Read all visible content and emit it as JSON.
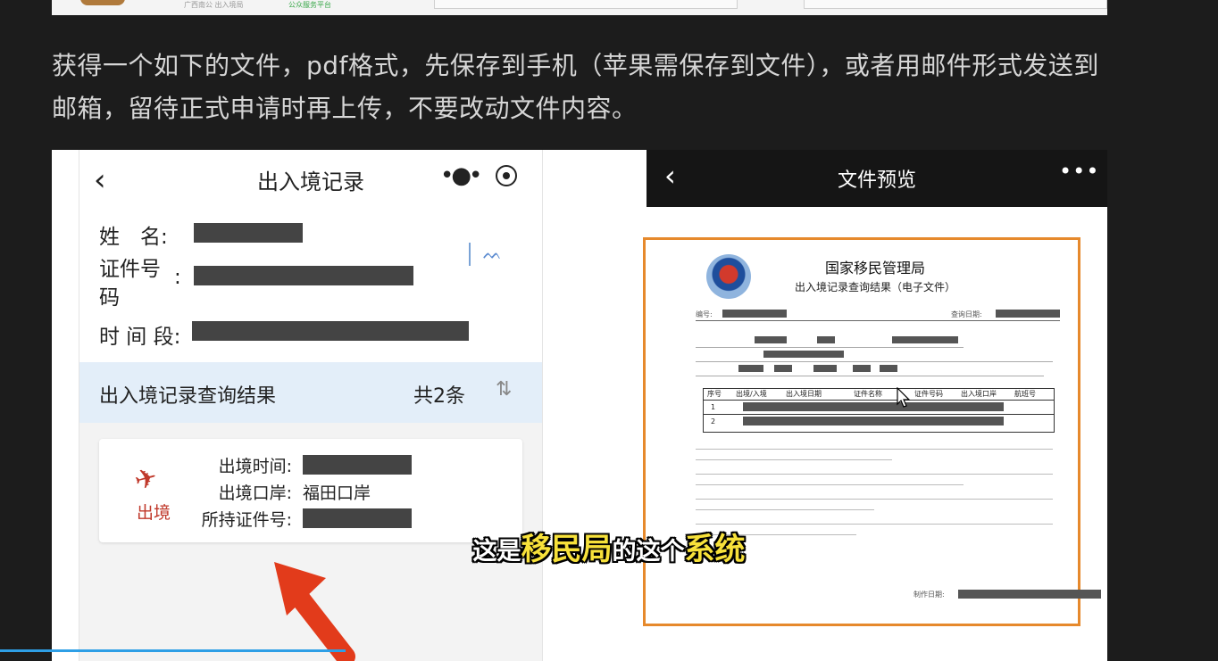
{
  "top_strip": {
    "left_text": "广西南公 出入境局",
    "green_text": "公众服务平台"
  },
  "intro_text": "获得一个如下的文件，pdf格式，先保存到手机（苹果需保存到文件），或者用邮件形式发送到邮箱，留待正式申请时再上传，不要改动文件内容。",
  "phone": {
    "title": "出入境记录",
    "fields": {
      "name_label": "姓　名:",
      "id_label": "证件号",
      "id_label_line2": "码",
      "id_colon": ":",
      "period_label": "时 间 段:"
    },
    "result_bar": {
      "title": "出入境记录查询结果",
      "count": "共2条"
    },
    "record": {
      "tag": "出境",
      "time_label": "出境时间:",
      "port_label": "出境口岸:",
      "port_value": "福田口岸",
      "doc_label": "所持证件号:"
    }
  },
  "viewer": {
    "title": "文件预览",
    "doc_org": "国家移民管理局",
    "doc_subtitle": "出入境记录查询结果（电子文件）",
    "doc_no_label": "编号:",
    "doc_date_label": "查询日期:",
    "table_headers": [
      "序号",
      "出境/入境",
      "出入境日期",
      "证件名称",
      "证件号码",
      "出入境口岸",
      "航班号"
    ],
    "row_numbers": [
      "1",
      "2"
    ],
    "sign_label": "制作日期:"
  },
  "subtitle": {
    "part1": "这是",
    "hl1": "移民局",
    "part2": "的这个",
    "hl2": "系统"
  },
  "progress": {
    "fraction": 0.284
  },
  "colors": {
    "accent_orange": "#e6892c",
    "progress_blue": "#2e9fe6",
    "subtitle_highlight": "#f7e13a"
  }
}
